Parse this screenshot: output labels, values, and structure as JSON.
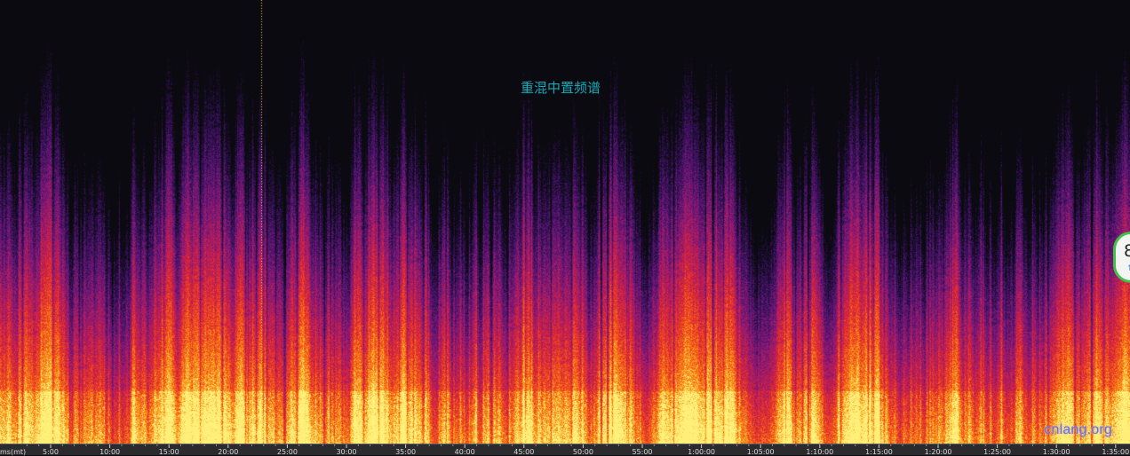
{
  "chart_data": {
    "type": "heatmap",
    "title": "重混中置频谱",
    "x_axis": {
      "unit_label": "ms(mt)",
      "tick_labels": [
        "5:00",
        "10:00",
        "15:00",
        "20:00",
        "25:00",
        "30:00",
        "35:00",
        "40:00",
        "45:00",
        "50:00",
        "55:00",
        "1:00:00",
        "1:05:00",
        "1:10:00",
        "1:15:00",
        "1:20:00",
        "1:25:00",
        "1:30:00",
        "1:35:00"
      ],
      "range_seconds": [
        0,
        5760
      ]
    },
    "colormap": [
      "#0b0a10",
      "#2c0f4e",
      "#5e1675",
      "#9c1a6e",
      "#d4213f",
      "#f04a1c",
      "#fb9a16",
      "#fff07a"
    ],
    "playhead_time": "23:00"
  },
  "watermark": "cnlang.org",
  "meter": {
    "value": "8",
    "arrow": "↑"
  },
  "colors": {
    "title": "#19a7b4",
    "playhead": "#e8d84a",
    "ring": "#3ec24a"
  }
}
